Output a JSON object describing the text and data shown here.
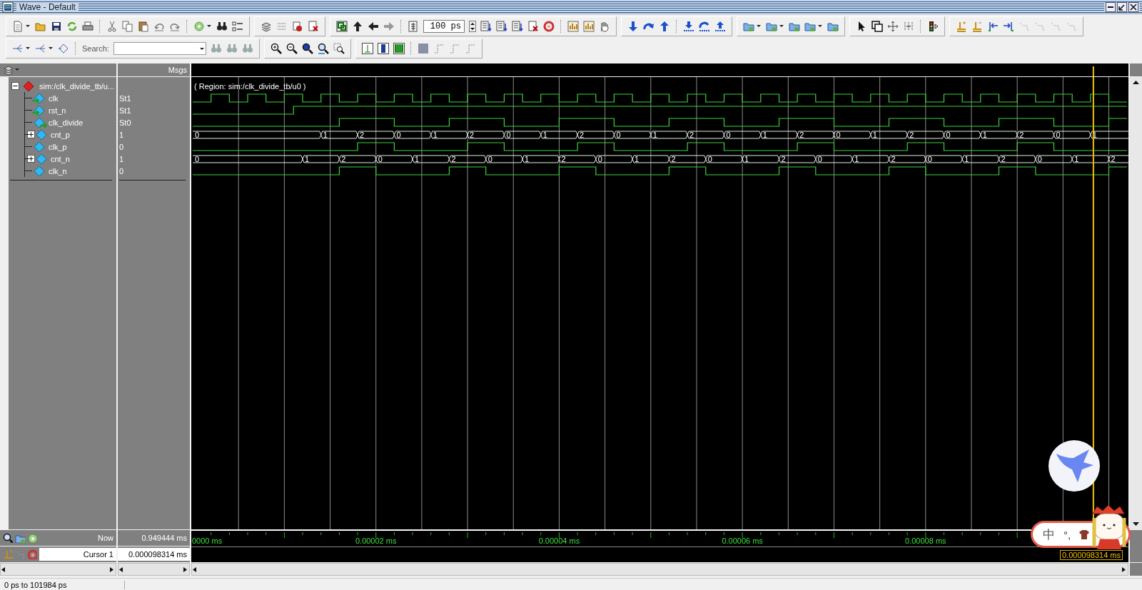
{
  "window": {
    "title": "Wave - Default"
  },
  "toolbar": {
    "time_step": "100 ps",
    "search_label": "Search:"
  },
  "panes": {
    "values_header": "Msgs"
  },
  "root": {
    "name": "sim:/clk_divide_tb/u...",
    "expanded": true,
    "region": "( Region: sim:/clk_divide_tb/u0 )",
    "children": [
      {
        "name": "clk",
        "kind": "in",
        "value": "St1"
      },
      {
        "name": "rst_n",
        "kind": "in",
        "value": "St1"
      },
      {
        "name": "clk_divide",
        "kind": "out",
        "value": "St0"
      },
      {
        "name": "cnt_p",
        "kind": "bus",
        "value": "1",
        "expanded": false,
        "values": [
          "0",
          "1",
          "2",
          "0",
          "1",
          "2",
          "0",
          "1",
          "2",
          "0",
          "1",
          "2",
          "0",
          "1",
          "2",
          "0",
          "1",
          "2",
          "0",
          "1",
          "2",
          "0",
          "1"
        ]
      },
      {
        "name": "clk_p",
        "kind": "bit",
        "value": "0"
      },
      {
        "name": "cnt_n",
        "kind": "bus",
        "value": "1",
        "expanded": false,
        "values": [
          "0",
          "1",
          "2",
          "0",
          "1",
          "2",
          "0",
          "1",
          "2",
          "0",
          "1",
          "2",
          "0",
          "1",
          "2",
          "0",
          "1",
          "2",
          "0",
          "1",
          "2",
          "0",
          "1",
          "2"
        ]
      },
      {
        "name": "clk_n",
        "kind": "bit",
        "value": "0"
      }
    ]
  },
  "timeline": {
    "now_label": "Now",
    "now_value": "0.949444 ms",
    "ticks": [
      "0000 ms",
      "0.00002 ms",
      "0.00004 ms",
      "0.00006 ms",
      "0.00008 ms"
    ]
  },
  "cursors": [
    {
      "name": "Cursor 1",
      "value": "0.000098314 ms",
      "label": "0.000098314 ms"
    }
  ],
  "status_bar": {
    "range": "0 ps to 101984 ps"
  },
  "input_method": {
    "mode": "中",
    "punctuation": "°,"
  }
}
